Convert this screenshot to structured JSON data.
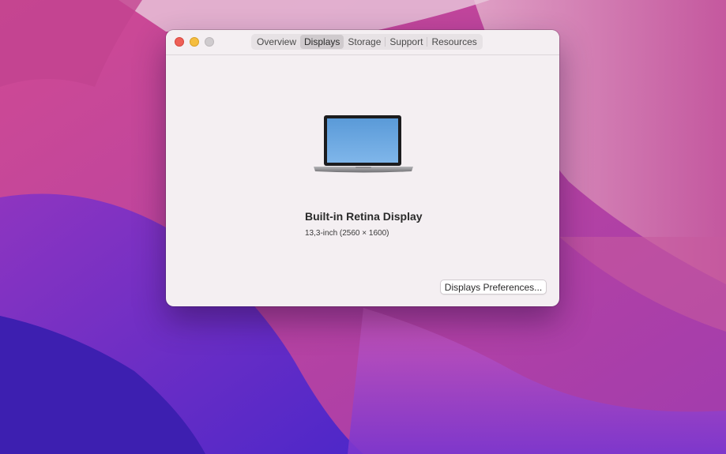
{
  "window": {
    "tabs": [
      {
        "label": "Overview",
        "selected": false
      },
      {
        "label": "Displays",
        "selected": true
      },
      {
        "label": "Storage",
        "selected": false
      },
      {
        "label": "Support",
        "selected": false
      },
      {
        "label": "Resources",
        "selected": false
      }
    ],
    "traffic_lights": {
      "close_color": "#ee5f57",
      "minimize_color": "#f5bd3f",
      "zoom_color": "#cfcbce"
    }
  },
  "display": {
    "icon": "laptop-icon",
    "name": "Built-in Retina Display",
    "spec": "13,3-inch (2560 × 1600)"
  },
  "actions": {
    "preferences_label": "Displays Preferences..."
  }
}
